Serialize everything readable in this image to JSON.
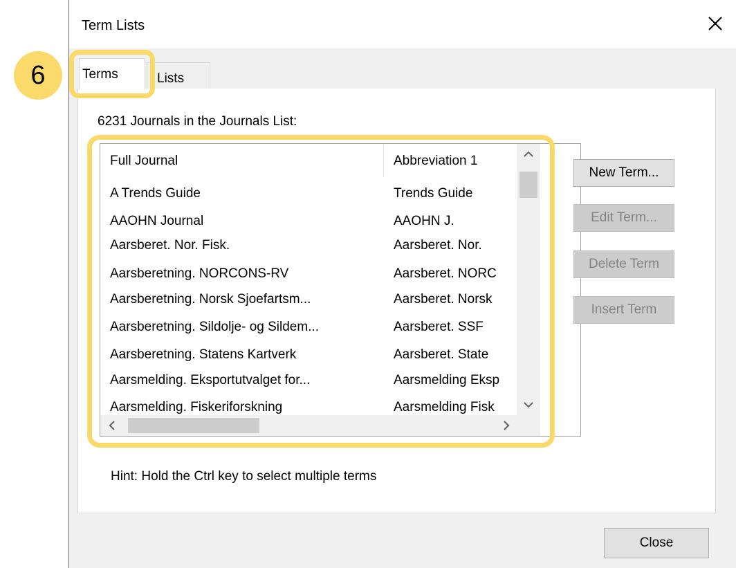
{
  "window": {
    "title": "Term Lists"
  },
  "step_badge": "6",
  "tabs": [
    {
      "label": "Terms",
      "active": true
    },
    {
      "label": "Lists",
      "active": false
    }
  ],
  "count_label": "6231 Journals in the Journals List:",
  "list": {
    "columns": [
      "Full Journal",
      "Abbreviation 1"
    ],
    "rows": [
      [
        "A Trends Guide",
        "Trends Guide"
      ],
      [
        "AAOHN Journal",
        "AAOHN J."
      ],
      [
        "Aarsberet. Nor. Fisk.",
        "Aarsberet. Nor."
      ],
      [
        "Aarsberetning. NORCONS-RV",
        "Aarsberet. NORC"
      ],
      [
        "Aarsberetning. Norsk Sjoefartsm...",
        "Aarsberet. Norsk"
      ],
      [
        "Aarsberetning. Sildolje- og Sildem...",
        "Aarsberet. SSF"
      ],
      [
        "Aarsberetning. Statens Kartverk",
        "Aarsberet. State"
      ],
      [
        "Aarsmelding. Eksportutvalget for...",
        "Aarsmelding Eksp"
      ],
      [
        "Aarsmelding. Fiskeriforskning",
        "Aarsmelding Fisk"
      ]
    ]
  },
  "buttons": {
    "new_term": "New Term...",
    "edit_term": "Edit Term...",
    "delete_term": "Delete Term",
    "insert_term": "Insert Term",
    "close": "Close"
  },
  "hint": "Hint: Hold the Ctrl key to select multiple terms",
  "colors": {
    "highlight": "#fad96b",
    "badge": "#fbda6c",
    "dialog_bg": "#f0f0f0"
  }
}
